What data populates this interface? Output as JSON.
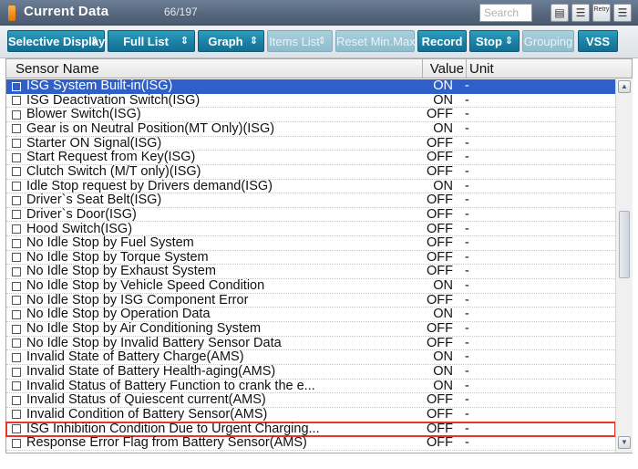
{
  "window": {
    "title": "Current Data",
    "count": "66/197",
    "search_placeholder": "Search",
    "icons": [
      "find-icon",
      "list-icon",
      "retry-icon",
      "menu-icon"
    ],
    "retry_label": "Retry"
  },
  "toolbar": {
    "selective_display": "Selective Display",
    "full_list": "Full List",
    "graph": "Graph",
    "items_list": "Items List",
    "reset_min_max": "Reset Min.Max",
    "record": "Record",
    "stop": "Stop",
    "grouping": "Grouping",
    "vss": "VSS"
  },
  "table": {
    "headers": {
      "name": "Sensor Name",
      "value": "Value",
      "unit": "Unit"
    },
    "rows": [
      {
        "name": "ISG System Built-in(ISG)",
        "value": "ON",
        "unit": "-"
      },
      {
        "name": "ISG Deactivation Switch(ISG)",
        "value": "ON",
        "unit": "-"
      },
      {
        "name": "Blower Switch(ISG)",
        "value": "OFF",
        "unit": "-"
      },
      {
        "name": "Gear is on Neutral Position(MT Only)(ISG)",
        "value": "ON",
        "unit": "-"
      },
      {
        "name": "Starter ON Signal(ISG)",
        "value": "OFF",
        "unit": "-"
      },
      {
        "name": "Start Request from Key(ISG)",
        "value": "OFF",
        "unit": "-"
      },
      {
        "name": "Clutch Switch (M/T only)(ISG)",
        "value": "OFF",
        "unit": "-"
      },
      {
        "name": "Idle Stop request by Drivers demand(ISG)",
        "value": "ON",
        "unit": "-"
      },
      {
        "name": "Driver`s Seat Belt(ISG)",
        "value": "OFF",
        "unit": "-"
      },
      {
        "name": "Driver`s Door(ISG)",
        "value": "OFF",
        "unit": "-"
      },
      {
        "name": "Hood Switch(ISG)",
        "value": "OFF",
        "unit": "-"
      },
      {
        "name": "No Idle Stop by Fuel System",
        "value": "OFF",
        "unit": "-"
      },
      {
        "name": "No Idle Stop by Torque System",
        "value": "OFF",
        "unit": "-"
      },
      {
        "name": "No Idle Stop by Exhaust System",
        "value": "OFF",
        "unit": "-"
      },
      {
        "name": "No Idle Stop by Vehicle Speed Condition",
        "value": "ON",
        "unit": "-"
      },
      {
        "name": "No Idle Stop by ISG Component Error",
        "value": "OFF",
        "unit": "-"
      },
      {
        "name": "No Idle Stop by Operation Data",
        "value": "ON",
        "unit": "-"
      },
      {
        "name": "No Idle Stop by Air Conditioning System",
        "value": "OFF",
        "unit": "-"
      },
      {
        "name": "No Idle Stop by Invalid Battery Sensor Data",
        "value": "OFF",
        "unit": "-"
      },
      {
        "name": "Invalid State of Battery Charge(AMS)",
        "value": "ON",
        "unit": "-"
      },
      {
        "name": "Invalid State of Battery Health-aging(AMS)",
        "value": "ON",
        "unit": "-"
      },
      {
        "name": "Invalid Status of Battery Function to crank the e...",
        "value": "ON",
        "unit": "-"
      },
      {
        "name": "Invalid Status of Quiescent current(AMS)",
        "value": "OFF",
        "unit": "-"
      },
      {
        "name": "Invalid Condition of Battery Sensor(AMS)",
        "value": "OFF",
        "unit": "-"
      },
      {
        "name": "ISG Inhibition Condition Due to Urgent Charging...",
        "value": "OFF",
        "unit": "-"
      },
      {
        "name": "Response Error Flag from Battery Sensor(AMS)",
        "value": "OFF",
        "unit": "-"
      }
    ],
    "selected_row": "ISG System Built-in(ISG)",
    "highlighted_row": "ISG Inhibition Condition Due to Urgent Charging..."
  },
  "colors": {
    "title_bar": "#56677d",
    "button": "#1a7fa3",
    "selected_row": "#2f60c9",
    "highlight_outline": "#e6352b"
  }
}
